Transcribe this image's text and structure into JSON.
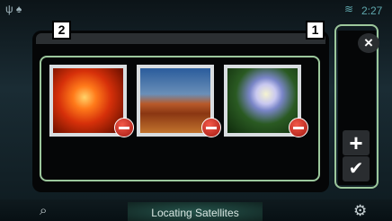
{
  "status_bar": {
    "left_icons": "ψ ♠",
    "wifi_icon": "wifi-icon",
    "wifi_glyph": "≋",
    "time": "2:27"
  },
  "callouts": {
    "right_column": "1",
    "image_grid": "2"
  },
  "buttons": {
    "close": "×",
    "add": "+",
    "confirm": "✔"
  },
  "thumbnails": [
    {
      "name": "flower-red",
      "remove_icon": "minus-icon"
    },
    {
      "name": "desert-mesa",
      "remove_icon": "minus-icon"
    },
    {
      "name": "hydrangea-blue",
      "remove_icon": "minus-icon"
    }
  ],
  "bottom_bar": {
    "status_text": "Locating Satellites",
    "left_icon_glyph": "⌕",
    "right_icon_glyph": "⚙"
  },
  "colors": {
    "callout_frame": "#9cc79c",
    "minus_badge": "#d8281a",
    "status_accent": "#5fa7ad"
  }
}
